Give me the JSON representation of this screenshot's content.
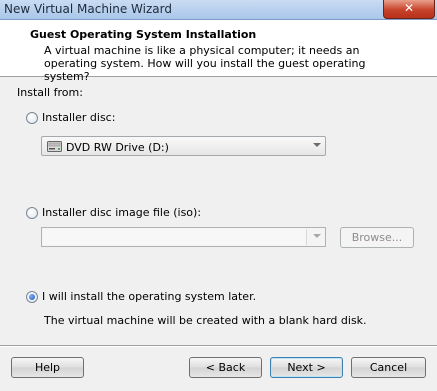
{
  "window": {
    "title": "New Virtual Machine Wizard",
    "close_glyph": "✕"
  },
  "header": {
    "title": "Guest Operating System Installation",
    "description": "A virtual machine is like a physical computer; it needs an operating system. How will you install the guest operating system?"
  },
  "install_from": {
    "label": "Install from:",
    "options": [
      {
        "label": "Installer disc:",
        "selected": false
      },
      {
        "label": "Installer disc image file (iso):",
        "selected": false
      },
      {
        "label": "I will install the operating system later.",
        "selected": true
      }
    ],
    "disc_select": {
      "value": "DVD RW Drive (D:)",
      "icon": "dvd-drive-icon"
    },
    "iso_select": {
      "value": ""
    },
    "browse_label": "Browse...",
    "later_description": "The virtual machine will be created with a blank hard disk."
  },
  "buttons": {
    "help": "Help",
    "back": "< Back",
    "next": "Next >",
    "cancel": "Cancel"
  }
}
